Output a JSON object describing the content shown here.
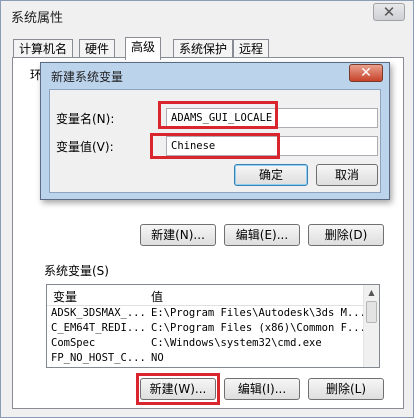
{
  "window": {
    "title": "系统属性",
    "close_glyph": "✕"
  },
  "tabs": [
    "计算机名",
    "硬件",
    "高级",
    "系统保护",
    "远程"
  ],
  "env_group_label": "环境",
  "user_buttons": {
    "new": "新建(N)...",
    "edit": "编辑(E)...",
    "delete": "删除(D)"
  },
  "system_vars": {
    "label": "系统变量(S)",
    "headers": [
      "变量",
      "值"
    ],
    "rows": [
      [
        "ADSK_3DSMAX_...",
        "E:\\Program Files\\Autodesk\\3ds M..."
      ],
      [
        "C_EM64T_REDI...",
        "C:\\Program Files (x86)\\Common F..."
      ],
      [
        "ComSpec",
        "C:\\Windows\\system32\\cmd.exe"
      ],
      [
        "FP_NO_HOST_C...",
        "NO"
      ]
    ],
    "buttons": {
      "new": "新建(W)...",
      "edit": "编辑(I)...",
      "delete": "删除(L)"
    }
  },
  "dialog": {
    "title": "新建系统变量",
    "close_glyph": "✕",
    "name_label": "变量名(N):",
    "name_value": "ADAMS_GUI_LOCALE",
    "value_label": "变量值(V):",
    "value_value": "Chinese",
    "ok": "确定",
    "cancel": "取消"
  },
  "colors": {
    "highlight": "#d9252e",
    "dialog_frame": "#bcd3ec"
  }
}
